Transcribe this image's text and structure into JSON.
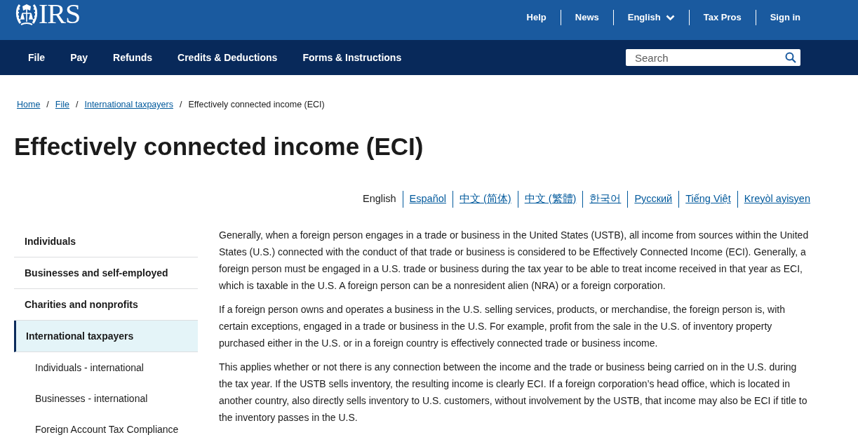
{
  "header": {
    "logo": {
      "text": "IRS"
    },
    "utility_links": [
      {
        "label": "Help",
        "kind": "link"
      },
      {
        "label": "News",
        "kind": "link"
      },
      {
        "label": "English",
        "kind": "dropdown"
      },
      {
        "label": "Tax Pros",
        "kind": "link"
      },
      {
        "label": "Sign in",
        "kind": "link"
      }
    ]
  },
  "main_nav": {
    "items": [
      {
        "label": "File"
      },
      {
        "label": "Pay"
      },
      {
        "label": "Refunds"
      },
      {
        "label": "Credits & Deductions"
      },
      {
        "label": "Forms & Instructions"
      }
    ],
    "search": {
      "placeholder": "Search"
    }
  },
  "breadcrumb": {
    "separator": "/",
    "items": [
      {
        "label": "Home",
        "current": false
      },
      {
        "label": "File",
        "current": false
      },
      {
        "label": "International taxpayers",
        "current": false
      },
      {
        "label": "Effectively connected income (ECI)",
        "current": true
      }
    ]
  },
  "page_title": "Effectively connected income (ECI)",
  "languages": [
    {
      "label": "English",
      "selected": true
    },
    {
      "label": "Español",
      "selected": false
    },
    {
      "label": "中文 (简体)",
      "selected": false
    },
    {
      "label": "中文 (繁體)",
      "selected": false
    },
    {
      "label": "한국어",
      "selected": false
    },
    {
      "label": "Русский",
      "selected": false
    },
    {
      "label": "Tiếng Việt",
      "selected": false
    },
    {
      "label": "Kreyòl ayisyen",
      "selected": false
    }
  ],
  "sidebar": {
    "items": [
      {
        "label": "Individuals",
        "selected": false
      },
      {
        "label": "Businesses and self-employed",
        "selected": false
      },
      {
        "label": "Charities and nonprofits",
        "selected": false
      },
      {
        "label": "International taxpayers",
        "selected": true,
        "children": [
          {
            "label": "Individuals - international",
            "selected": false
          },
          {
            "label": "Businesses - international",
            "selected": false
          },
          {
            "label": "Foreign Account Tax Compliance",
            "selected": false
          }
        ]
      }
    ]
  },
  "content": {
    "paragraphs": [
      "Generally, when a foreign person engages in a trade or business in the United States (USTB), all income from sources within the United States (U.S.) connected with the conduct of that trade or business is considered to be Effectively Connected Income (ECI). Generally, a foreign person must be engaged in a U.S. trade or business during the tax year to be able to treat income received in that year as ECI, which is taxable in the U.S. A foreign person can be a nonresident alien (NRA) or a foreign corporation.",
      "If a foreign person owns and operates a business in the U.S. selling services, products, or merchandise, the foreign person is, with certain exceptions, engaged in a trade or business in the U.S. For example, profit from the sale in the U.S. of inventory property purchased either in the U.S. or in a foreign country is effectively connected trade or business income.",
      "This applies whether or not there is any connection between the income and the trade or business being carried on in the U.S. during the tax year. If the USTB sells inventory, the resulting income is clearly ECI. If a foreign corporation’s head office, which is located in another country, also directly sells inventory to U.S. customers, without involvement by the USTB, that income may also be ECI if title to the inventory passes in the U.S."
    ]
  }
}
